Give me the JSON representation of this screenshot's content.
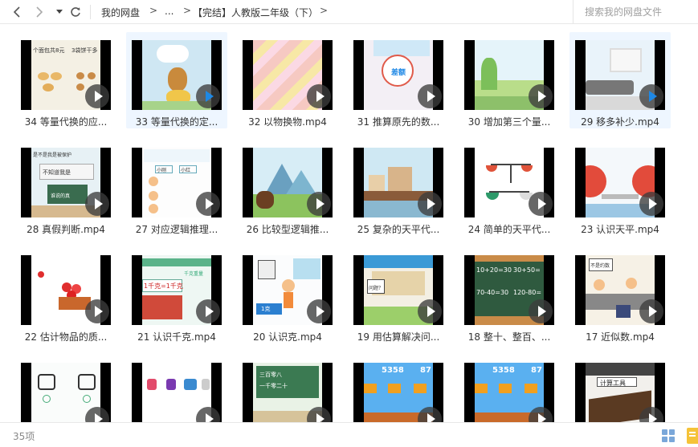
{
  "toolbar": {
    "breadcrumb": [
      "我的网盘",
      "...",
      "【完结】人教版二年级（下）"
    ],
    "search_placeholder": "搜索我的网盘文件"
  },
  "files": [
    {
      "name": "34 等量代换的应...",
      "art": "bread",
      "hover": false
    },
    {
      "name": "33 等量代换的定...",
      "art": "monkey",
      "hover": true
    },
    {
      "name": "32 以物换物.mp4",
      "art": "stripes",
      "hover": false
    },
    {
      "name": "31 推算原先的数...",
      "art": "bubble",
      "hover": false
    },
    {
      "name": "30 增加第三个量...",
      "art": "hills",
      "hover": false
    },
    {
      "name": "29 移多补少.mp4",
      "art": "room",
      "hover": true
    },
    {
      "name": "28 真假判断.mp4",
      "art": "classroom",
      "hover": false
    },
    {
      "name": "27 对应逻辑推理...",
      "art": "logic",
      "hover": false
    },
    {
      "name": "26 比较型逻辑推...",
      "art": "mountain",
      "hover": false
    },
    {
      "name": "25 复杂的天平代...",
      "art": "city",
      "hover": false
    },
    {
      "name": "24 简单的天平代...",
      "art": "balance",
      "hover": false
    },
    {
      "name": "23 认识天平.mp4",
      "art": "scale",
      "hover": false
    },
    {
      "name": "22 估计物品的质...",
      "art": "apples",
      "hover": false
    },
    {
      "name": "21 认识千克.mp4",
      "art": "kg",
      "hover": false
    },
    {
      "name": "20 认识克.mp4",
      "art": "gram",
      "hover": false
    },
    {
      "name": "19 用估算解决问...",
      "art": "street",
      "hover": false
    },
    {
      "name": "18 整十、整百、...",
      "art": "board",
      "hover": false
    },
    {
      "name": "17 近似数.mp4",
      "art": "family",
      "hover": false
    },
    {
      "name": "",
      "art": "clock",
      "hover": false
    },
    {
      "name": "",
      "art": "tools",
      "hover": false
    },
    {
      "name": "",
      "art": "green",
      "hover": false
    },
    {
      "name": "",
      "art": "game",
      "hover": false
    },
    {
      "name": "",
      "art": "game",
      "hover": false
    },
    {
      "name": "",
      "art": "abacus",
      "hover": false
    }
  ],
  "thumb_text": {
    "t34a": "个面包共8元",
    "t34b": "3袋饼干多",
    "t31": "差额",
    "t28a": "是不是我是被保护",
    "t28b": "不知道我是",
    "t28c": "谁说的真",
    "t27a": "小刚",
    "t27b": "小红",
    "t21": "1千克=1千克",
    "t21b": "千克重量",
    "t20": "1克",
    "t19": "问题？",
    "t18a": "10+20=30",
    "t18b": "30+50=",
    "t18c": "70-40=30",
    "t18d": "120-80=",
    "t17": "不是约数",
    "t3a": "三百零八",
    "t3b": "一千零二十",
    "t5a": "5358",
    "t5b": "87",
    "t6": "计算工具"
  },
  "status": {
    "count": "35项"
  },
  "colors": {
    "accent": "#1e88e5",
    "hover_bg": "#eef6ff"
  }
}
